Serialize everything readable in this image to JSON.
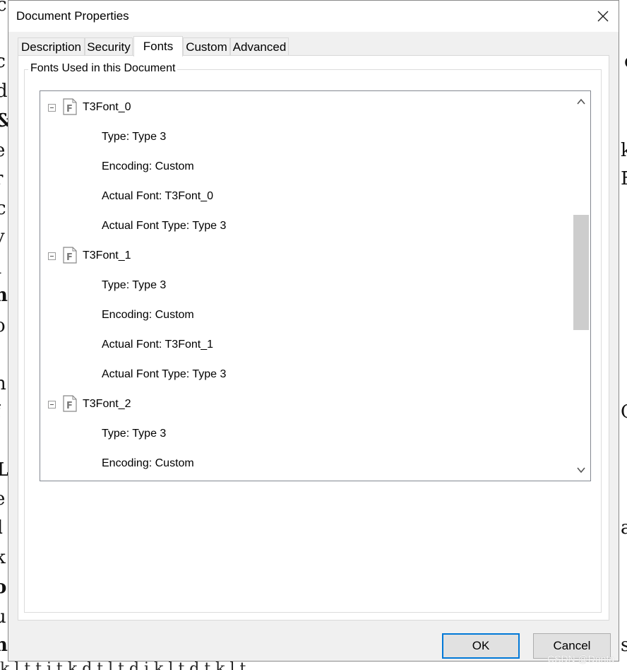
{
  "window": {
    "title": "Document Properties"
  },
  "tabs": [
    {
      "label": "Description"
    },
    {
      "label": "Security"
    },
    {
      "label": "Fonts"
    },
    {
      "label": "Custom"
    },
    {
      "label": "Advanced"
    }
  ],
  "active_tab": "Fonts",
  "fonts_group": {
    "label": "Fonts Used in this Document",
    "fonts": [
      {
        "name": "T3Font_0",
        "expanded": true,
        "details": [
          "Type: Type 3",
          "Encoding: Custom",
          "Actual Font: T3Font_0",
          "Actual Font Type: Type 3"
        ]
      },
      {
        "name": "T3Font_1",
        "expanded": true,
        "details": [
          "Type: Type 3",
          "Encoding: Custom",
          "Actual Font: T3Font_1",
          "Actual Font Type: Type 3"
        ]
      },
      {
        "name": "T3Font_2",
        "expanded": true,
        "details": [
          "Type: Type 3",
          "Encoding: Custom"
        ]
      }
    ]
  },
  "buttons": {
    "ok": "OK",
    "cancel": "Cancel"
  },
  "watermark": "CSDN @Donta",
  "colors": {
    "accent": "#0078d7",
    "dialog_bg": "#f0f0f0",
    "scroll_thumb": "#cdcdcd"
  },
  "icons": {
    "close": "close-icon",
    "expander": "minus-box-icon",
    "font_file": "font-file-icon",
    "scroll_up": "chevron-up-icon",
    "scroll_down": "chevron-down-icon"
  }
}
